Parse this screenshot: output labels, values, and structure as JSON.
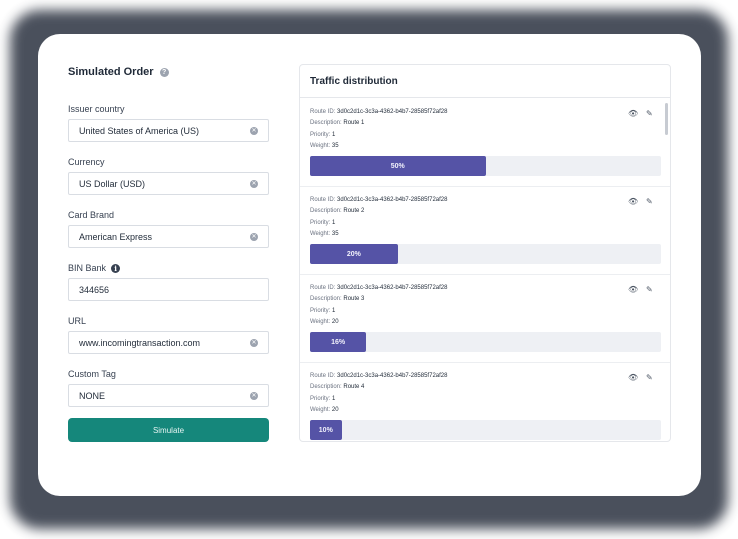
{
  "form": {
    "title": "Simulated Order",
    "fields": [
      {
        "label": "Issuer country",
        "value": "United States of America (US)",
        "clearable": true
      },
      {
        "label": "Currency",
        "value": "US Dollar (USD)",
        "clearable": true
      },
      {
        "label": "Card Brand",
        "value": "American Express",
        "clearable": true
      },
      {
        "label": "BIN Bank",
        "value": "344656",
        "clearable": false
      },
      {
        "label": "URL",
        "value": "www.incomingtransaction.com",
        "clearable": true
      },
      {
        "label": "Custom Tag",
        "value": "NONE",
        "clearable": true
      }
    ],
    "simulate_label": "Simulate"
  },
  "traffic": {
    "title": "Traffic distribution",
    "labels": {
      "route_id": "Route ID:",
      "description": "Description:",
      "priority": "Priority:",
      "weight": "Weight:"
    },
    "routes": [
      {
        "route_id": "3d0c2d1c-3c3a-4362-b4b7-28585f72af28",
        "description": "Route 1",
        "priority": "1",
        "weight": "35",
        "percent_label": "50%",
        "percent": 50
      },
      {
        "route_id": "3d0c2d1c-3c3a-4362-b4b7-28585f72af28",
        "description": "Route 2",
        "priority": "1",
        "weight": "35",
        "percent_label": "20%",
        "percent": 25
      },
      {
        "route_id": "3d0c2d1c-3c3a-4362-b4b7-28585f72af28",
        "description": "Route 3",
        "priority": "1",
        "weight": "20",
        "percent_label": "16%",
        "percent": 16
      },
      {
        "route_id": "3d0c2d1c-3c3a-4362-b4b7-28585f72af28",
        "description": "Route 4",
        "priority": "1",
        "weight": "20",
        "percent_label": "10%",
        "percent": 9
      }
    ]
  },
  "colors": {
    "primary_button": "#15877b",
    "bar_fill": "#5553a6",
    "bar_track": "#eef0f4"
  },
  "icons": {
    "help": "question-circle-icon",
    "info": "info-circle-icon",
    "clear": "clear-circle-icon",
    "view": "eye-icon",
    "edit": "edit-icon"
  }
}
